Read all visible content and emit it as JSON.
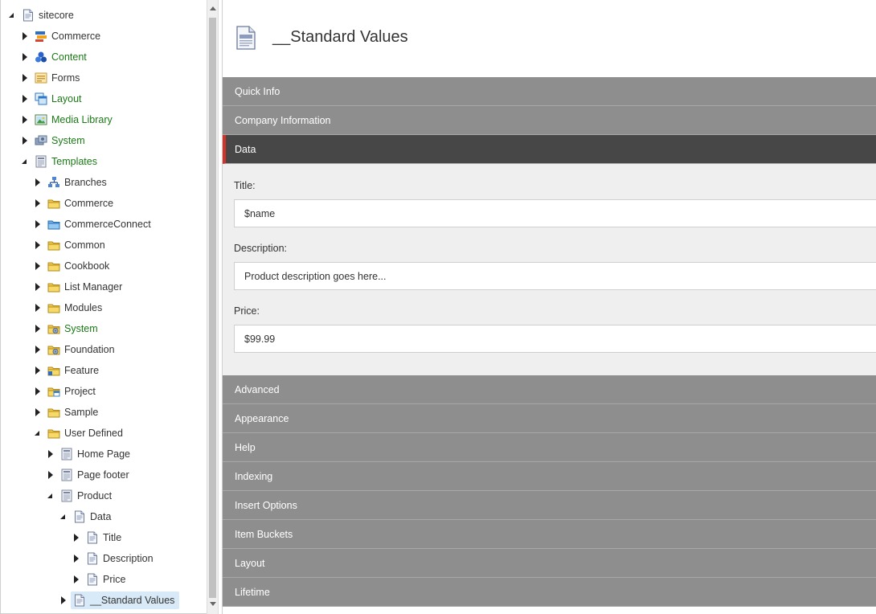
{
  "tree": {
    "items": [
      {
        "label": "sitecore",
        "level": 0,
        "state": "expanded",
        "icon": "document-icon",
        "green": false,
        "selected": false
      },
      {
        "label": "Commerce",
        "level": 1,
        "state": "collapsed",
        "icon": "commerce-icon",
        "green": false,
        "selected": false
      },
      {
        "label": "Content",
        "level": 1,
        "state": "collapsed",
        "icon": "content-icon",
        "green": true,
        "selected": false
      },
      {
        "label": "Forms",
        "level": 1,
        "state": "collapsed",
        "icon": "forms-icon",
        "green": false,
        "selected": false
      },
      {
        "label": "Layout",
        "level": 1,
        "state": "collapsed",
        "icon": "layout-icon",
        "green": true,
        "selected": false
      },
      {
        "label": "Media Library",
        "level": 1,
        "state": "collapsed",
        "icon": "media-library-icon",
        "green": true,
        "selected": false
      },
      {
        "label": "System",
        "level": 1,
        "state": "collapsed",
        "icon": "system-icon",
        "green": true,
        "selected": false
      },
      {
        "label": "Templates",
        "level": 1,
        "state": "expanded",
        "icon": "template-icon",
        "green": true,
        "selected": false
      },
      {
        "label": "Branches",
        "level": 2,
        "state": "collapsed",
        "icon": "branches-icon",
        "green": false,
        "selected": false
      },
      {
        "label": "Commerce",
        "level": 2,
        "state": "collapsed",
        "icon": "folder-icon",
        "green": false,
        "selected": false
      },
      {
        "label": "CommerceConnect",
        "level": 2,
        "state": "collapsed",
        "icon": "blue-folder-icon",
        "green": false,
        "selected": false
      },
      {
        "label": "Common",
        "level": 2,
        "state": "collapsed",
        "icon": "folder-icon",
        "green": false,
        "selected": false
      },
      {
        "label": "Cookbook",
        "level": 2,
        "state": "collapsed",
        "icon": "folder-icon",
        "green": false,
        "selected": false
      },
      {
        "label": "List Manager",
        "level": 2,
        "state": "collapsed",
        "icon": "folder-icon",
        "green": false,
        "selected": false
      },
      {
        "label": "Modules",
        "level": 2,
        "state": "collapsed",
        "icon": "folder-icon",
        "green": false,
        "selected": false
      },
      {
        "label": "System",
        "level": 2,
        "state": "collapsed",
        "icon": "system-folder-icon",
        "green": true,
        "selected": false
      },
      {
        "label": "Foundation",
        "level": 2,
        "state": "collapsed",
        "icon": "system-folder-icon",
        "green": false,
        "selected": false
      },
      {
        "label": "Feature",
        "level": 2,
        "state": "collapsed",
        "icon": "feature-folder-icon",
        "green": false,
        "selected": false
      },
      {
        "label": "Project",
        "level": 2,
        "state": "collapsed",
        "icon": "project-folder-icon",
        "green": false,
        "selected": false
      },
      {
        "label": "Sample",
        "level": 2,
        "state": "collapsed",
        "icon": "folder-icon",
        "green": false,
        "selected": false
      },
      {
        "label": "User Defined",
        "level": 2,
        "state": "expanded",
        "icon": "folder-icon",
        "green": false,
        "selected": false
      },
      {
        "label": "Home Page",
        "level": 3,
        "state": "collapsed",
        "icon": "template-icon",
        "green": false,
        "selected": false
      },
      {
        "label": "Page footer",
        "level": 3,
        "state": "collapsed",
        "icon": "template-icon",
        "green": false,
        "selected": false
      },
      {
        "label": "Product",
        "level": 3,
        "state": "expanded",
        "icon": "template-icon",
        "green": false,
        "selected": false
      },
      {
        "label": "Data",
        "level": 4,
        "state": "expanded",
        "icon": "document-icon",
        "green": false,
        "selected": false
      },
      {
        "label": "Title",
        "level": 5,
        "state": "collapsed",
        "icon": "document-icon",
        "green": false,
        "selected": false
      },
      {
        "label": "Description",
        "level": 5,
        "state": "collapsed",
        "icon": "document-icon",
        "green": false,
        "selected": false
      },
      {
        "label": "Price",
        "level": 5,
        "state": "collapsed",
        "icon": "document-icon",
        "green": false,
        "selected": false
      },
      {
        "label": "__Standard Values",
        "level": 4,
        "state": "collapsed",
        "icon": "document-icon",
        "green": false,
        "selected": true
      }
    ]
  },
  "header": {
    "title": "__Standard Values",
    "icon": "document-icon"
  },
  "sections_before": [
    {
      "label": "Quick Info"
    },
    {
      "label": "Company Information"
    }
  ],
  "active_section": {
    "label": "Data"
  },
  "fields": {
    "title": {
      "label": "Title:",
      "value": "$name"
    },
    "description": {
      "label": "Description:",
      "value": "Product description goes here..."
    },
    "price": {
      "label": "Price:",
      "value": "$99.99"
    }
  },
  "sections_after": [
    {
      "label": "Advanced"
    },
    {
      "label": "Appearance"
    },
    {
      "label": "Help"
    },
    {
      "label": "Indexing"
    },
    {
      "label": "Insert Options"
    },
    {
      "label": "Item Buckets"
    },
    {
      "label": "Layout"
    },
    {
      "label": "Lifetime"
    }
  ],
  "colors": {
    "accent": "#d3322a",
    "section_bg": "#8e8e8e",
    "active_section_bg": "#474747",
    "tree_green": "#1b7a16",
    "selected_bg": "#d8eaf7"
  }
}
